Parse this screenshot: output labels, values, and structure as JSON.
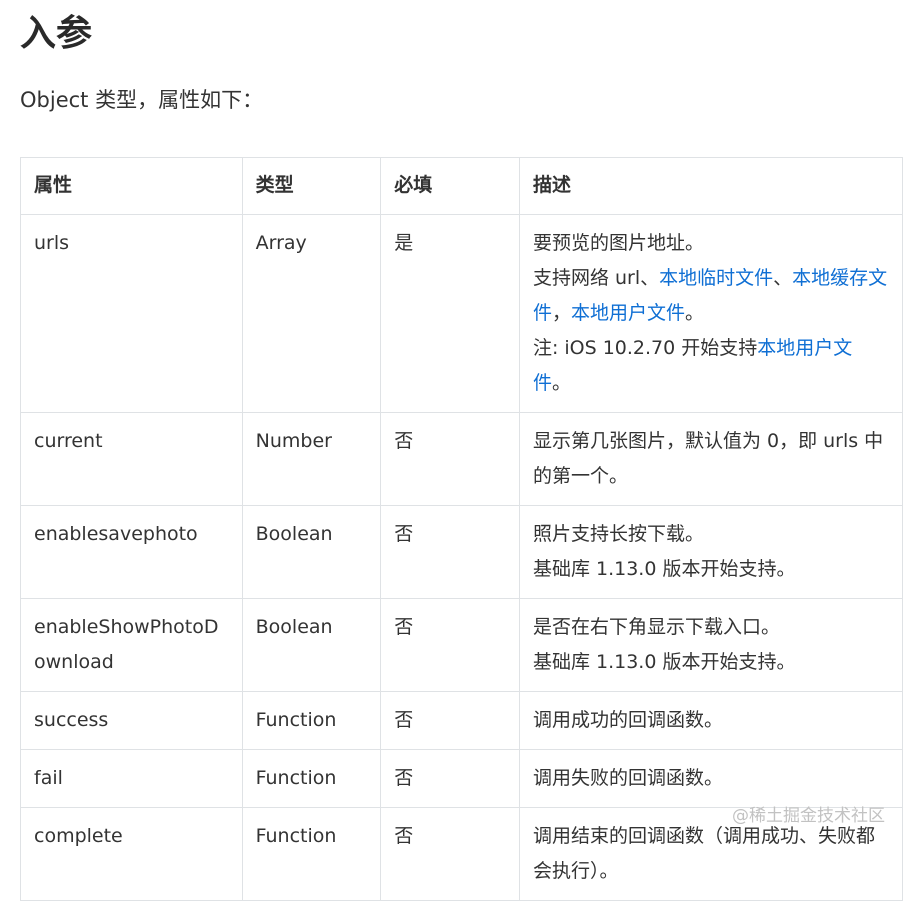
{
  "title": "入参",
  "intro": "Object 类型，属性如下：",
  "table": {
    "headers": [
      "属性",
      "类型",
      "必填",
      "描述"
    ],
    "rows": [
      {
        "name": "urls",
        "type": "Array",
        "required": "是",
        "desc": [
          [
            {
              "t": "要预览的图片地址。"
            }
          ],
          [
            {
              "t": "支持网络 url、"
            },
            {
              "t": "本地临时文件",
              "link": true
            },
            {
              "t": "、"
            },
            {
              "t": "本地缓存文件",
              "link": true
            },
            {
              "t": "，"
            },
            {
              "t": "本地用户文件",
              "link": true
            },
            {
              "t": "。"
            }
          ],
          [
            {
              "t": "注: iOS 10.2.70 开始支持"
            },
            {
              "t": "本地用户文件",
              "link": true
            },
            {
              "t": "。"
            }
          ]
        ]
      },
      {
        "name": "current",
        "type": "Number",
        "required": "否",
        "desc": [
          [
            {
              "t": "显示第几张图片，默认值为 0，即 urls 中的第一个。"
            }
          ]
        ]
      },
      {
        "name": "enablesavephoto",
        "type": "Boolean",
        "required": "否",
        "desc": [
          [
            {
              "t": "照片支持长按下载。"
            }
          ],
          [
            {
              "t": "基础库 1.13.0 版本开始支持。"
            }
          ]
        ]
      },
      {
        "name": "enableShowPhotoDownload",
        "type": "Boolean",
        "required": "否",
        "desc": [
          [
            {
              "t": "是否在右下角显示下载入口。"
            }
          ],
          [
            {
              "t": "基础库 1.13.0 版本开始支持。"
            }
          ]
        ]
      },
      {
        "name": "success",
        "type": "Function",
        "required": "否",
        "desc": [
          [
            {
              "t": "调用成功的回调函数。"
            }
          ]
        ]
      },
      {
        "name": "fail",
        "type": "Function",
        "required": "否",
        "desc": [
          [
            {
              "t": "调用失败的回调函数。"
            }
          ]
        ]
      },
      {
        "name": "complete",
        "type": "Function",
        "required": "否",
        "desc": [
          [
            {
              "t": "调用结束的回调函数（调用成功、失败都会执行）。"
            }
          ]
        ]
      }
    ]
  },
  "watermark": "@稀土掘金技术社区",
  "colors": {
    "link": "#0f6fd4",
    "border": "#dfe2e5",
    "text": "#333333"
  }
}
